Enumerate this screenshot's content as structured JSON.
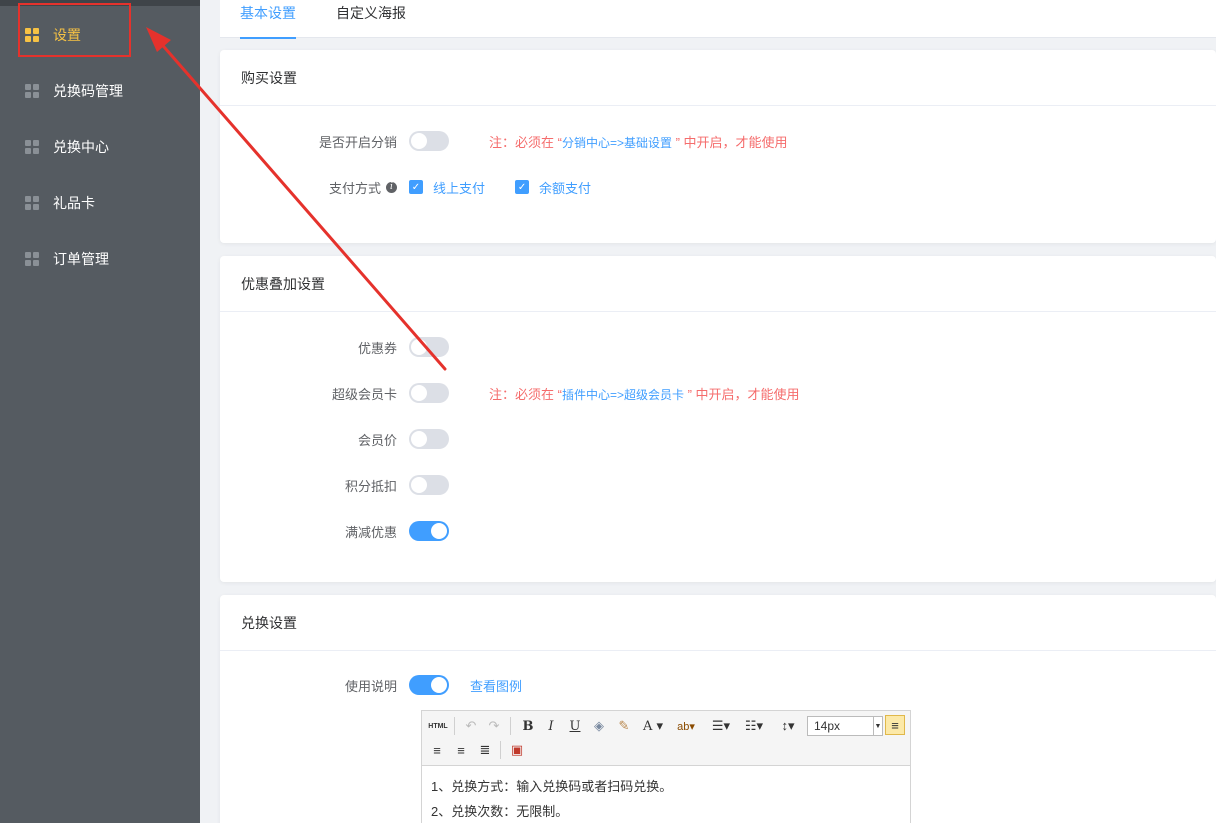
{
  "sidebar": {
    "items": [
      {
        "label": "设置",
        "icon": "grid-icon",
        "active": true
      },
      {
        "label": "兑换码管理",
        "icon": "grid-icon"
      },
      {
        "label": "兑换中心",
        "icon": "grid-icon"
      },
      {
        "label": "礼品卡",
        "icon": "grid-icon"
      },
      {
        "label": "订单管理",
        "icon": "grid-icon"
      }
    ]
  },
  "tabs": [
    {
      "label": "基本设置",
      "active": true
    },
    {
      "label": "自定义海报"
    }
  ],
  "purchase": {
    "title": "购买设置",
    "distribution_label": "是否开启分销",
    "distribution_on": false,
    "distribution_note_prefix": "注：必须在 “",
    "distribution_note_path": "分销中心=>基础设置",
    "distribution_note_suffix": " ” 中开启，才能使用",
    "payment_label": "支付方式",
    "payment_options": [
      {
        "label": "线上支付",
        "checked": true
      },
      {
        "label": "余额支付",
        "checked": true
      }
    ]
  },
  "discount": {
    "title": "优惠叠加设置",
    "coupon_label": "优惠券",
    "coupon_on": false,
    "supercard_label": "超级会员卡",
    "supercard_on": false,
    "supercard_note_prefix": "注：必须在 “",
    "supercard_note_path": "插件中心=>超级会员卡",
    "supercard_note_suffix": " ” 中开启，才能使用",
    "member_price_label": "会员价",
    "member_price_on": false,
    "points_label": "积分抵扣",
    "points_on": false,
    "full_reduction_label": "满减优惠",
    "full_reduction_on": true
  },
  "exchange": {
    "title": "兑换设置",
    "instructions_label": "使用说明",
    "instructions_on": true,
    "view_example": "查看图例",
    "editor": {
      "html_btn": "HTML",
      "font_size": "14px",
      "lines": [
        "1、兑换方式：输入兑换码或者扫码兑换。",
        "2、兑换次数：无限制。"
      ]
    }
  },
  "colors": {
    "accent": "#409eff",
    "warning": "#f56c6c",
    "sidebar_bg": "#555b61",
    "sidebar_active": "#f6c244",
    "highlight_box": "#e5322c"
  }
}
